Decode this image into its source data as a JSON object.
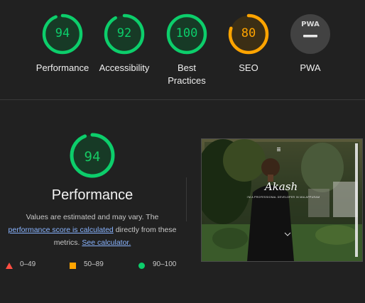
{
  "categories": [
    {
      "score": "94",
      "label": "Performance",
      "value": 0.94,
      "color": "#0cce6b",
      "text_color": "#0cce6b",
      "fill": "#173a26"
    },
    {
      "score": "92",
      "label": "Accessibility",
      "value": 0.92,
      "color": "#0cce6b",
      "text_color": "#0cce6b",
      "fill": "#173a26"
    },
    {
      "score": "100",
      "label": "Best Practices",
      "value": 1.0,
      "color": "#0cce6b",
      "text_color": "#0cce6b",
      "fill": "#173a26"
    },
    {
      "score": "80",
      "label": "SEO",
      "value": 0.8,
      "color": "#ffa400",
      "text_color": "#ffa400",
      "fill": "#3b2e15"
    }
  ],
  "pwa": {
    "badge_text": "PWA",
    "label": "PWA"
  },
  "performance": {
    "score": "94",
    "value": 0.94,
    "title": "Performance",
    "desc_prefix": "Values are estimated and may vary. The",
    "score_link": "performance score is calculated",
    "desc_middle": "directly from these metrics.",
    "calc_link": "See calculator."
  },
  "legend": [
    {
      "range": "0–49",
      "color": "#ff4e42",
      "shape": "triangle"
    },
    {
      "range": "50–89",
      "color": "#ffa400",
      "shape": "square"
    },
    {
      "range": "90–100",
      "color": "#0cce6b",
      "shape": "circle"
    }
  ],
  "screenshot": {
    "name": "Akash",
    "tagline": "I'M A PROFESSIONAL DEVELOPER IN MALAPPURAM"
  }
}
